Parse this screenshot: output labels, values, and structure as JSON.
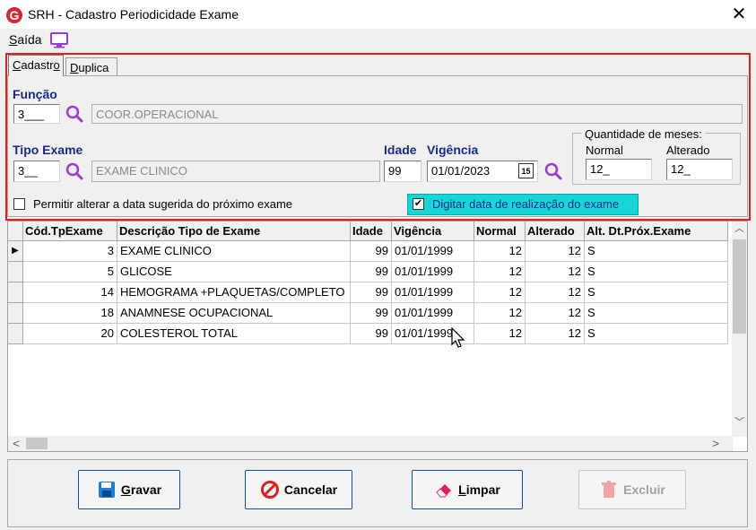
{
  "window": {
    "title": "SRH - Cadastro Periodicidade Exame",
    "close_glyph": "✕"
  },
  "menu": {
    "saida_first": "S",
    "saida_rest": "aída"
  },
  "tabs": [
    {
      "first": "C",
      "rest": "adastr",
      "underline": "o",
      "tail": ""
    },
    {
      "first": "D",
      "rest": "uplica"
    }
  ],
  "form": {
    "funcao_label": "Função",
    "funcao_code": "3___",
    "funcao_desc": "COOR.OPERACIONAL",
    "tipo_exame_label": "Tipo Exame",
    "tipo_exame_code": "3__",
    "tipo_exame_desc": "EXAME CLINICO",
    "idade_label": "Idade",
    "idade_value": "99",
    "vigencia_label": "Vigência",
    "vigencia_value": "01/01/2023",
    "calendar_glyph": "15",
    "qtd_meses_label": "Quantidade de meses:",
    "normal_label": "Normal",
    "normal_value": "12_",
    "alterado_label": "Alterado",
    "alterado_value": "12_",
    "permitir_label": "Permitir alterar a data sugerida do próximo exame",
    "digitar_label": "Digitar data de realização do exame",
    "digitar_checked_glyph": "✔"
  },
  "grid": {
    "columns": [
      "Cód.TpExame",
      "Descrição Tipo de Exame",
      "Idade",
      "Vigência",
      "Normal",
      "Alterado",
      "Alt. Dt.Próx.Exame"
    ],
    "rows": [
      [
        "3",
        "EXAME CLINICO",
        "99",
        "01/01/1999",
        "12",
        "12",
        "S"
      ],
      [
        "5",
        "GLICOSE",
        "99",
        "01/01/1999",
        "12",
        "12",
        "S"
      ],
      [
        "14",
        "HEMOGRAMA +PLAQUETAS/COMPLETO",
        "99",
        "01/01/1999",
        "12",
        "12",
        "S"
      ],
      [
        "18",
        "ANAMNESE OCUPACIONAL",
        "99",
        "01/01/1999",
        "12",
        "12",
        "S"
      ],
      [
        "20",
        "COLESTEROL TOTAL",
        "99",
        "01/01/1999",
        "12",
        "12",
        "S"
      ]
    ],
    "current_row_glyph": "▶",
    "scroll_up": "︿",
    "scroll_down": "﹀",
    "scroll_left": "<",
    "scroll_right": ">"
  },
  "buttons": {
    "gravar_first": "G",
    "gravar_rest": "ravar",
    "cancelar": "Cancelar",
    "limpar_first": "L",
    "limpar_rest": "impar",
    "excluir": "Excluir"
  },
  "colors": {
    "accent_red": "#e02020",
    "highlight": "#16d6d6",
    "label_blue": "#1a2a8a",
    "button_border": "#0a4ea8",
    "search_icon": "#9b3bd6"
  },
  "icons": [
    "app-logo-icon",
    "monitor-icon",
    "search-icon",
    "calendar-icon",
    "save-icon",
    "cancel-icon",
    "eraser-icon",
    "trash-icon"
  ]
}
